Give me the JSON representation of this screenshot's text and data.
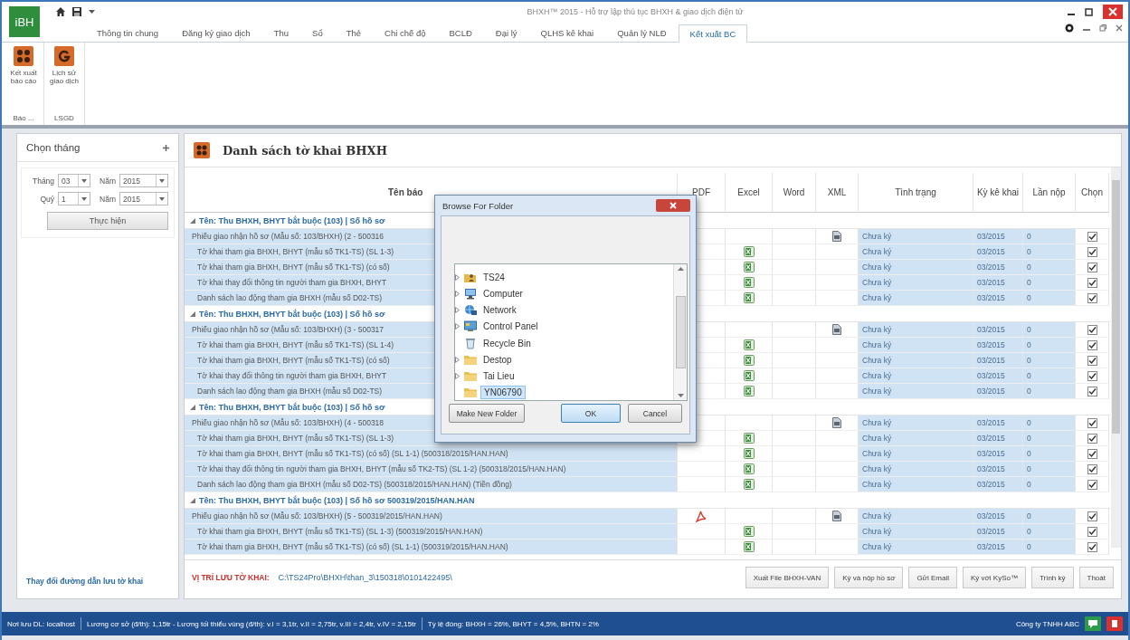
{
  "window": {
    "logo": "iBH",
    "title": "BHXH™ 2015 - Hỗ trợ lập thủ tục BHXH & giao dịch điện tử"
  },
  "tabs": [
    {
      "label": "Thông tin chung",
      "selected": false
    },
    {
      "label": "Đăng ký giao dịch",
      "selected": false
    },
    {
      "label": "Thu",
      "selected": false
    },
    {
      "label": "Sổ",
      "selected": false
    },
    {
      "label": "Thẻ",
      "selected": false
    },
    {
      "label": "Chi chế độ",
      "selected": false
    },
    {
      "label": "BCLĐ",
      "selected": false
    },
    {
      "label": "Đại lý",
      "selected": false
    },
    {
      "label": "QLHS kê khai",
      "selected": false
    },
    {
      "label": "Quản lý NLĐ",
      "selected": false
    },
    {
      "label": "Kết xuất BC",
      "selected": true
    }
  ],
  "ribbon": {
    "buttons": [
      {
        "label": "Kết xuất báo cáo",
        "kind": "report",
        "group": "Báo ..."
      },
      {
        "label": "Lịch sử giao dịch",
        "kind": "history",
        "group": "LSGD"
      }
    ]
  },
  "left_panel": {
    "title": "Chọn tháng",
    "fields": [
      {
        "label": "Tháng",
        "value": "03"
      },
      {
        "label": "Năm",
        "value": "2015"
      },
      {
        "label": "Quý",
        "value": "1"
      },
      {
        "label": "Năm",
        "value": "2015"
      }
    ],
    "button": "Thực hiện",
    "link": "Thay đổi đường dẫn lưu tờ khai"
  },
  "list": {
    "title": "Danh sách tờ khai BHXH",
    "columns": [
      "Tên báo",
      "PDF",
      "Excel",
      "Word",
      "XML",
      "Tình trạng",
      "Kỳ kê khai",
      "Lần nộp",
      "Chọn"
    ],
    "groups": [
      {
        "title": "Tên: Thu BHXH, BHYT bắt buộc (103) | Số hồ sơ",
        "rows": [
          {
            "name": "Phiếu giao nhận hồ sơ (Mẫu số: 103/BHXH) (2 - 500316",
            "pdf": false,
            "excel": false,
            "xml": true,
            "status": "Chưa ký",
            "period": "03/2015",
            "count": "0",
            "checked": true
          },
          {
            "name": "Tờ khai tham gia BHXH, BHYT (mẫu số TK1-TS) (SL 1-3)",
            "pdf": false,
            "excel": true,
            "xml": false,
            "status": "Chưa ký",
            "period": "03/2015",
            "count": "0",
            "checked": true
          },
          {
            "name": "Tờ khai tham gia BHXH, BHYT (mẫu số TK1-TS) (có số)",
            "pdf": false,
            "excel": true,
            "xml": false,
            "status": "Chưa ký",
            "period": "03/2015",
            "count": "0",
            "checked": true
          },
          {
            "name": "Tờ khai thay đổi thông tin người tham gia BHXH, BHYT",
            "pdf": false,
            "excel": true,
            "xml": false,
            "status": "Chưa ký",
            "period": "03/2015",
            "count": "0",
            "checked": true
          },
          {
            "name": "Danh sách lao động tham gia BHXH (mẫu số D02-TS)",
            "pdf": false,
            "excel": true,
            "xml": false,
            "status": "Chưa ký",
            "period": "03/2015",
            "count": "0",
            "checked": true
          }
        ]
      },
      {
        "title": "Tên: Thu BHXH, BHYT bắt buộc (103) | Số hồ sơ",
        "rows": [
          {
            "name": "Phiếu giao nhận hồ sơ (Mẫu số: 103/BHXH) (3 - 500317",
            "pdf": false,
            "excel": false,
            "xml": true,
            "status": "Chưa ký",
            "period": "03/2015",
            "count": "0",
            "checked": true
          },
          {
            "name": "Tờ khai tham gia BHXH, BHYT (mẫu số TK1-TS) (SL 1-4)",
            "pdf": false,
            "excel": true,
            "xml": false,
            "status": "Chưa ký",
            "period": "03/2015",
            "count": "0",
            "checked": true
          },
          {
            "name": "Tờ khai tham gia BHXH, BHYT (mẫu số TK1-TS) (có số)",
            "pdf": false,
            "excel": true,
            "xml": false,
            "status": "Chưa ký",
            "period": "03/2015",
            "count": "0",
            "checked": true
          },
          {
            "name": "Tờ khai thay đổi thông tin người tham gia BHXH, BHYT",
            "pdf": false,
            "excel": true,
            "xml": false,
            "status": "Chưa ký",
            "period": "03/2015",
            "count": "0",
            "checked": true
          },
          {
            "name": "Danh sách lao động tham gia BHXH (mẫu số D02-TS)",
            "pdf": false,
            "excel": true,
            "xml": false,
            "status": "Chưa ký",
            "period": "03/2015",
            "count": "0",
            "checked": true
          }
        ]
      },
      {
        "title": "Tên: Thu BHXH, BHYT bắt buộc (103) | Số hồ sơ",
        "rows": [
          {
            "name": "Phiếu giao nhận hồ sơ (Mẫu số: 103/BHXH) (4 - 500318",
            "pdf": false,
            "excel": false,
            "xml": true,
            "status": "Chưa ký",
            "period": "03/2015",
            "count": "0",
            "checked": true
          },
          {
            "name": "Tờ khai tham gia BHXH, BHYT (mẫu số TK1-TS) (SL 1-3)",
            "pdf": false,
            "excel": true,
            "xml": false,
            "status": "Chưa ký",
            "period": "03/2015",
            "count": "0",
            "checked": true
          },
          {
            "name": "Tờ khai tham gia BHXH, BHYT (mẫu số TK1-TS) (có số) (SL 1-1) (500318/2015/HAN.HAN)",
            "pdf": false,
            "excel": true,
            "xml": false,
            "status": "Chưa ký",
            "period": "03/2015",
            "count": "0",
            "checked": true
          },
          {
            "name": "Tờ khai thay đổi thông tin người tham gia BHXH, BHYT (mẫu số TK2-TS) (SL 1-2) (500318/2015/HAN.HAN)",
            "pdf": false,
            "excel": true,
            "xml": false,
            "status": "Chưa ký",
            "period": "03/2015",
            "count": "0",
            "checked": true
          },
          {
            "name": "Danh sách lao động tham gia BHXH (mẫu số D02-TS) (500318/2015/HAN.HAN) (Tiền đồng)",
            "pdf": false,
            "excel": true,
            "xml": false,
            "status": "Chưa ký",
            "period": "03/2015",
            "count": "0",
            "checked": true
          }
        ]
      },
      {
        "title": "Tên: Thu BHXH, BHYT bắt buộc (103) | Số hồ sơ 500319/2015/HAN.HAN",
        "rows": [
          {
            "name": "Phiếu giao nhận hồ sơ (Mẫu số: 103/BHXH) (5 - 500319/2015/HAN.HAN)",
            "pdf": true,
            "excel": false,
            "xml": true,
            "status": "Chưa ký",
            "period": "03/2015",
            "count": "0",
            "checked": true
          },
          {
            "name": "Tờ khai tham gia BHXH, BHYT (mẫu số TK1-TS) (SL 1-3) (500319/2015/HAN.HAN)",
            "pdf": false,
            "excel": true,
            "xml": false,
            "status": "Chưa ký",
            "period": "03/2015",
            "count": "0",
            "checked": true
          },
          {
            "name": "Tờ khai tham gia BHXH, BHYT (mẫu số TK1-TS) (có số) (SL 1-1) (500319/2015/HAN.HAN)",
            "pdf": false,
            "excel": true,
            "xml": false,
            "status": "Chưa ký",
            "period": "03/2015",
            "count": "0",
            "checked": true
          }
        ]
      }
    ]
  },
  "save_location": {
    "label": "VỊ TRÍ LƯU TỜ KHAI:",
    "path": "C:\\TS24Pro\\BHXH\\than_3\\150318\\0101422495\\"
  },
  "actions": [
    "Xuất File BHXH-VAN",
    "Ký và nộp hồ sơ",
    "Gửi Email",
    "Ký với KySo™",
    "Trình ký",
    "Thoát"
  ],
  "dialog": {
    "title": "Browse For Folder",
    "folders": [
      {
        "label": "TS24",
        "kind": "user",
        "expandable": true,
        "selected": false
      },
      {
        "label": "Computer",
        "kind": "computer",
        "expandable": true,
        "selected": false
      },
      {
        "label": "Network",
        "kind": "network",
        "expandable": true,
        "selected": false
      },
      {
        "label": "Control Panel",
        "kind": "control-panel",
        "expandable": true,
        "selected": false
      },
      {
        "label": "Recycle Bin",
        "kind": "recycle-bin",
        "expandable": false,
        "selected": false
      },
      {
        "label": "Destop",
        "kind": "folder",
        "expandable": true,
        "selected": false
      },
      {
        "label": "Tai Lieu",
        "kind": "folder",
        "expandable": true,
        "selected": false
      },
      {
        "label": "YN06790",
        "kind": "folder",
        "expandable": false,
        "selected": true
      }
    ],
    "buttons": [
      "Make New Folder",
      "OK",
      "Cancel"
    ]
  },
  "status_bar": {
    "segments": [
      "Nơi lưu DL: localhost",
      "Lương cơ sở (đ/th): 1,15tr - Lương tối thiểu vùng (đ/th): v.I = 3,1tr, v.II = 2,75tr, v.III = 2,4tr, v.IV = 2,15tr",
      "Tỷ lệ đóng: BHXH = 26%, BHYT = 4,5%, BHTN = 2%"
    ],
    "company": "Công ty TNHH ABC"
  }
}
